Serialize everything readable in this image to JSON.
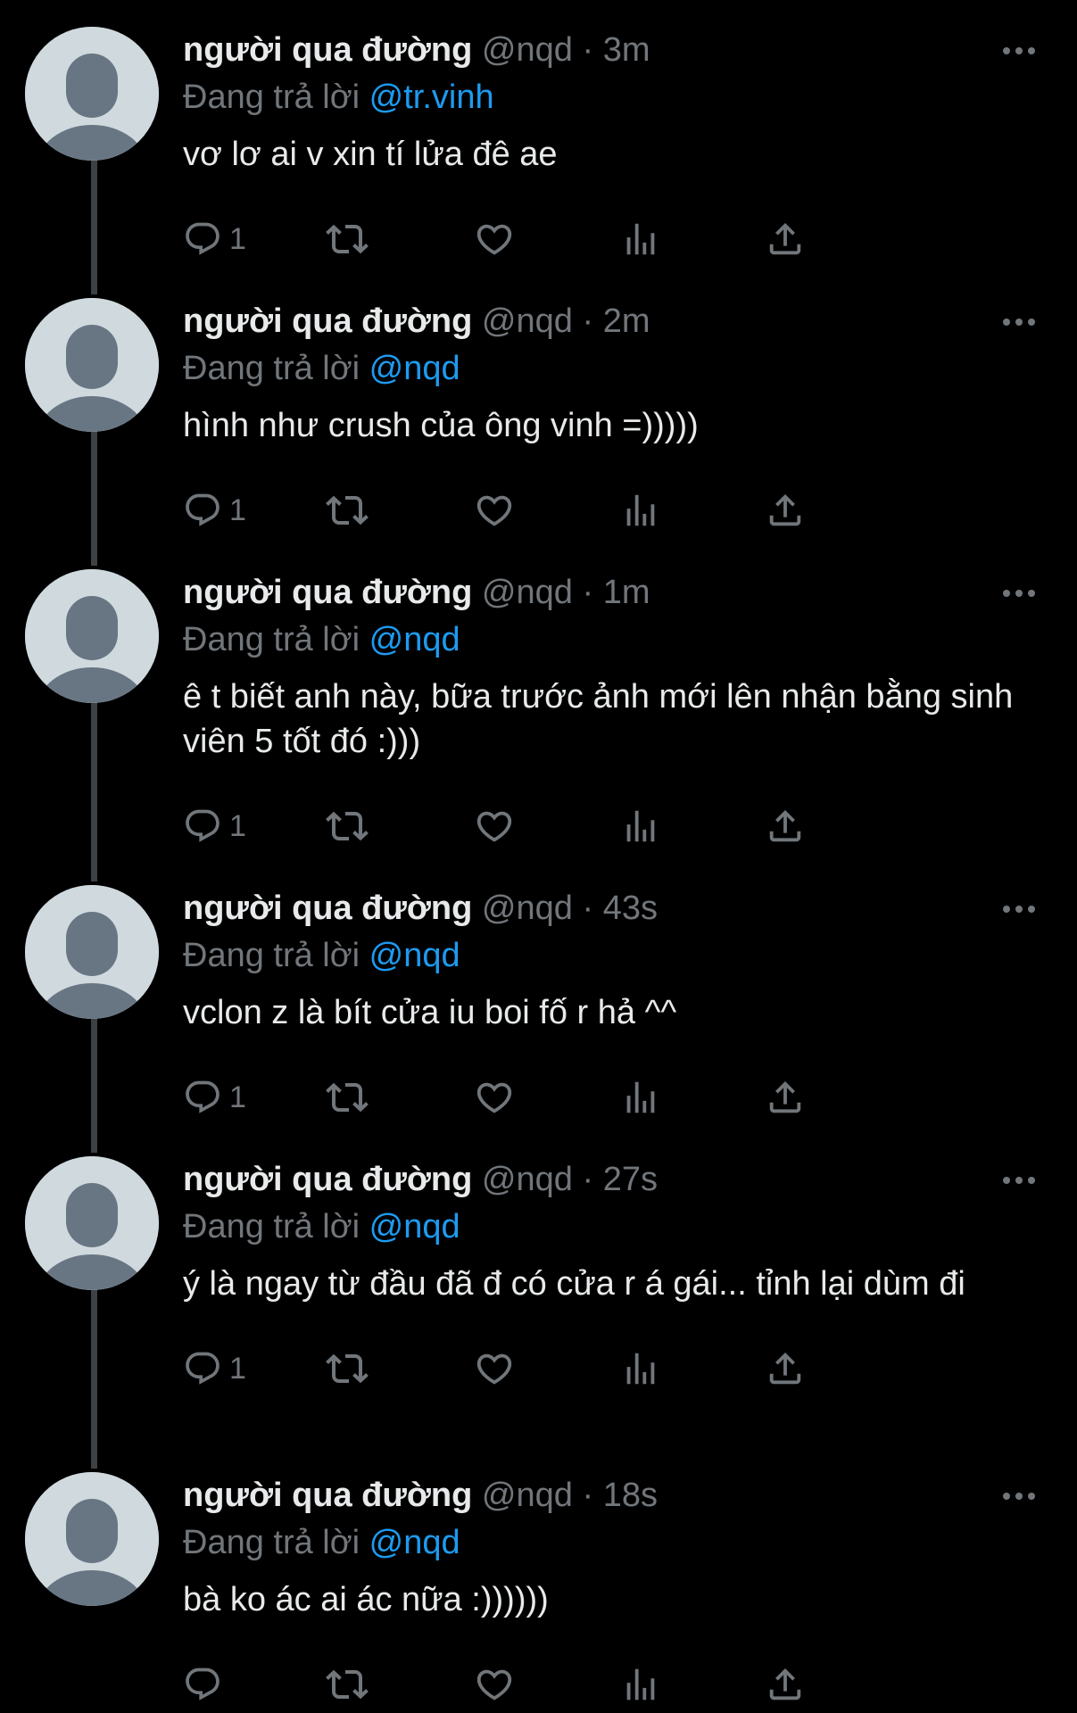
{
  "tweets": [
    {
      "name": "người qua đường",
      "handle": "@nqd",
      "separator": "·",
      "time": "3m",
      "reply_prefix": "Đang trả lời",
      "reply_to": "@tr.vinh",
      "text": "vơ lơ ai v xin tí lửa đê ae",
      "reply_count": "1"
    },
    {
      "name": "người qua đường",
      "handle": "@nqd",
      "separator": "·",
      "time": "2m",
      "reply_prefix": "Đang trả lời",
      "reply_to": "@nqd",
      "text": "hình như crush của ông vinh =)))))",
      "reply_count": "1"
    },
    {
      "name": "người qua đường",
      "handle": "@nqd",
      "separator": "·",
      "time": "1m",
      "reply_prefix": "Đang trả lời",
      "reply_to": "@nqd",
      "text": "ê t biết anh này, bữa trước ảnh mới lên nhận bằng sinh viên 5 tốt đó :)))",
      "reply_count": "1"
    },
    {
      "name": "người qua đường",
      "handle": "@nqd",
      "separator": "·",
      "time": "43s",
      "reply_prefix": "Đang trả lời",
      "reply_to": "@nqd",
      "text": "vclon z là bít cửa iu boi fố r hả ^^",
      "reply_count": "1"
    },
    {
      "name": "người qua đường",
      "handle": "@nqd",
      "separator": "·",
      "time": "27s",
      "reply_prefix": "Đang trả lời",
      "reply_to": "@nqd",
      "text": "ý là ngay từ đầu đã đ có cửa r á gái... tỉnh lại dùm đi",
      "reply_count": "1"
    },
    {
      "name": "người qua đường",
      "handle": "@nqd",
      "separator": "·",
      "time": "18s",
      "reply_prefix": "Đang trả lời",
      "reply_to": "@nqd",
      "text": "bà ko ác ai ác nữa :))))))",
      "reply_count": ""
    }
  ],
  "icons": {
    "reply": "reply-icon",
    "retweet": "retweet-icon",
    "like": "like-icon",
    "views": "views-icon",
    "share": "share-icon",
    "more": "more-icon",
    "avatar": "default-avatar-icon"
  },
  "colors": {
    "background": "#000000",
    "primary_text": "#e7e9ea",
    "secondary_text": "#71767b",
    "accent": "#1d9bf0",
    "thread_line": "#3e4144",
    "avatar_bg": "#cfd9de",
    "avatar_fg": "#687684"
  }
}
